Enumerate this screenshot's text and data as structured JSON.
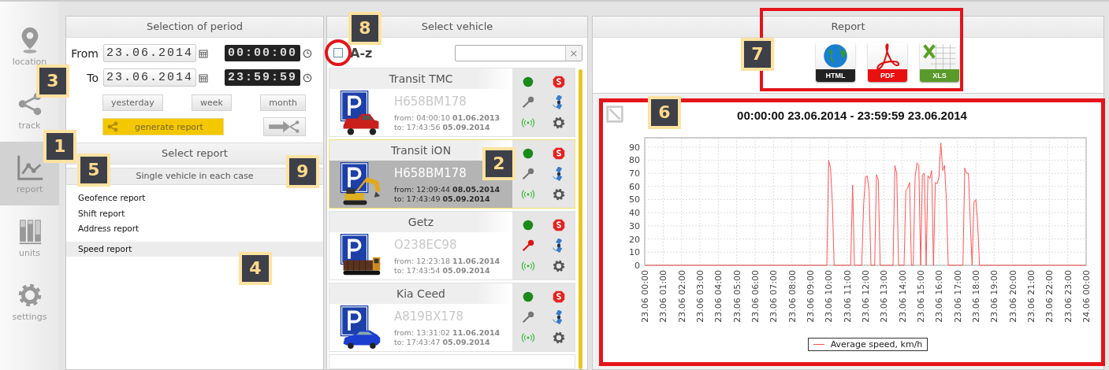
{
  "sidebar": {
    "items": [
      {
        "label": "location",
        "selected": false
      },
      {
        "label": "track",
        "selected": false
      },
      {
        "label": "report",
        "selected": true
      },
      {
        "label": "units",
        "selected": false
      },
      {
        "label": "settings",
        "selected": false
      }
    ]
  },
  "period": {
    "title": "Selection of period",
    "rows": [
      {
        "label": "From",
        "date": "23.06.2014",
        "time": "00:00:00"
      },
      {
        "label": "To",
        "date": "23.06.2014",
        "time": "23:59:59"
      }
    ],
    "presets": [
      "yesterday",
      "week",
      "month"
    ],
    "generate": "generate report"
  },
  "reports": {
    "title": "Select report",
    "group": "Single vehicle in each case",
    "items": [
      {
        "label": "Geofence report",
        "selected": false
      },
      {
        "label": "Shift report",
        "selected": false
      },
      {
        "label": "Address report",
        "selected": false
      },
      {
        "label": "Speed report",
        "selected": true
      }
    ]
  },
  "vehicles": {
    "title": "Select vehicle",
    "sort_label": "A-z",
    "sort_checked": false,
    "sort_highlighted": true,
    "search_clear": "×",
    "items": [
      {
        "name": "Transit TMC",
        "plate": "H658BM178",
        "from": "from: 04:00:10 **01.06.2013**",
        "to": "to: 17:43:56 **05.09.2014**",
        "kind": "pickup",
        "selected": false,
        "key_on": false
      },
      {
        "name": "Transit iON",
        "plate": "H658BM178",
        "from": "from: 12:09:44 **08.05.2014**",
        "to": "to: 17:43:49 **05.09.2014**",
        "kind": "excavator",
        "selected": true,
        "key_on": false
      },
      {
        "name": "Getz",
        "plate": "O238EC98",
        "from": "from: 12:23:18 **11.06.2014**",
        "to": "to: 17:43:54 **05.09.2014**",
        "kind": "truck",
        "selected": false,
        "key_on": true
      },
      {
        "name": "Kia Ceed",
        "plate": "A819BX178",
        "from": "from: 13:31:02 **11.06.2014**",
        "to": "to: 17:43:47 **05.09.2014**",
        "kind": "car",
        "selected": false,
        "key_on": false
      }
    ]
  },
  "report": {
    "title": "Report",
    "export_highlighted": true,
    "exports": [
      {
        "label": "HTML",
        "kind": "html"
      },
      {
        "label": "PDF",
        "kind": "pdf"
      },
      {
        "label": "XLS",
        "kind": "xls"
      }
    ],
    "chart_highlighted": true,
    "chart_title": "00:00:00 23.06.2014 - 23:59:59 23.06.2014",
    "chart_data": {
      "type": "line",
      "grid": true,
      "ylim": [
        0,
        97
      ],
      "yticks": [
        0,
        10,
        20,
        30,
        40,
        50,
        60,
        70,
        80,
        90
      ],
      "categories": [
        "23.06 00:00",
        null,
        null,
        null,
        null,
        null,
        null,
        null,
        null,
        null,
        "23.06 01:00",
        null,
        null,
        null,
        null,
        null,
        null,
        null,
        null,
        null,
        "23.06 02:00",
        null,
        null,
        null,
        null,
        null,
        null,
        null,
        null,
        null,
        "23.06 03:00",
        null,
        null,
        null,
        null,
        null,
        null,
        null,
        null,
        null,
        "23.06 04:00",
        null,
        null,
        null,
        null,
        null,
        null,
        null,
        null,
        null,
        "23.06 05:00",
        null,
        null,
        null,
        null,
        null,
        null,
        null,
        null,
        null,
        "23.06 06:00",
        null,
        null,
        null,
        null,
        null,
        null,
        null,
        null,
        null,
        "23.06 07:00",
        null,
        null,
        null,
        null,
        null,
        null,
        null,
        null,
        null,
        "23.06 08:00",
        null,
        null,
        null,
        null,
        null,
        null,
        null,
        null,
        null,
        "23.06 09:00",
        null,
        null,
        null,
        null,
        null,
        null,
        null,
        null,
        null,
        "23.06 10:00",
        null,
        null,
        null,
        null,
        null,
        null,
        null,
        null,
        null,
        "23.06 11:00",
        null,
        null,
        null,
        null,
        null,
        null,
        null,
        null,
        null,
        "23.06 12:00",
        null,
        null,
        null,
        null,
        null,
        null,
        null,
        null,
        null,
        "23.06 13:00",
        null,
        null,
        null,
        null,
        null,
        null,
        null,
        null,
        null,
        "23.06 14:00",
        null,
        null,
        null,
        null,
        null,
        null,
        null,
        null,
        null,
        "23.06 15:00",
        null,
        null,
        null,
        null,
        null,
        null,
        null,
        null,
        null,
        "23.06 16:00",
        null,
        null,
        null,
        null,
        null,
        null,
        null,
        null,
        null,
        "23.06 17:00",
        null,
        null,
        null,
        null,
        null,
        null,
        null,
        null,
        null,
        "23.06 18:00",
        null,
        null,
        null,
        null,
        null,
        null,
        null,
        null,
        null,
        "23.06 19:00",
        null,
        null,
        null,
        null,
        null,
        null,
        null,
        null,
        null,
        "23.06 20:00",
        null,
        null,
        null,
        null,
        null,
        null,
        null,
        null,
        null,
        "23.06 21:00",
        null,
        null,
        null,
        null,
        null,
        null,
        null,
        null,
        null,
        "23.06 22:00",
        null,
        null,
        null,
        null,
        null,
        null,
        null,
        null,
        null,
        "23.06 23:00",
        null,
        null,
        null,
        null,
        null,
        null,
        null,
        null,
        null,
        "24.06 00:00"
      ],
      "series": [
        {
          "name": "Average speed, km/h",
          "color": "#ff5555",
          "values": [
            0,
            0,
            0,
            0,
            0,
            0,
            0,
            0,
            0,
            0,
            0,
            0,
            0,
            0,
            0,
            0,
            0,
            0,
            0,
            0,
            0,
            0,
            0,
            0,
            0,
            0,
            0,
            0,
            0,
            0,
            0,
            0,
            0,
            0,
            0,
            0,
            0,
            0,
            0,
            0,
            0,
            0,
            0,
            0,
            0,
            0,
            0,
            0,
            0,
            0,
            0,
            0,
            0,
            0,
            0,
            0,
            0,
            0,
            0,
            0,
            0,
            0,
            0,
            0,
            0,
            0,
            0,
            0,
            0,
            0,
            0,
            0,
            0,
            0,
            0,
            0,
            0,
            0,
            0,
            0,
            0,
            0,
            0,
            0,
            0,
            0,
            0,
            0,
            0,
            0,
            0,
            0,
            0,
            0,
            0,
            0,
            0,
            0,
            0,
            0,
            80,
            74,
            48,
            0,
            0,
            0,
            0,
            0,
            0,
            0,
            0,
            0,
            0,
            61,
            0,
            0,
            0,
            0,
            0,
            46,
            67,
            68,
            56,
            0,
            0,
            0,
            69,
            65,
            0,
            0,
            0,
            0,
            0,
            0,
            0,
            0,
            76,
            70,
            0,
            0,
            0,
            0,
            57,
            59,
            63,
            0,
            0,
            67,
            78,
            76,
            0,
            69,
            70,
            0,
            68,
            66,
            72,
            0,
            63,
            62,
            67,
            93,
            72,
            76,
            50,
            0,
            0,
            0,
            0,
            0,
            0,
            0,
            0,
            0,
            74,
            70,
            70,
            33,
            0,
            48,
            50,
            33,
            0,
            0,
            0,
            0,
            0,
            0,
            0,
            0,
            0,
            0,
            0,
            0,
            0,
            0,
            0,
            0,
            0,
            0,
            0,
            0,
            0,
            0,
            0,
            0,
            0,
            0,
            0,
            0,
            0,
            0,
            0,
            0,
            0,
            0,
            0,
            0,
            0,
            0,
            0,
            0,
            0,
            0,
            0,
            0,
            0,
            0,
            0,
            0,
            0,
            0,
            0,
            0,
            0,
            0,
            0,
            0,
            0,
            0,
            0
          ]
        }
      ]
    }
  },
  "callouts": [
    "1",
    "2",
    "3",
    "4",
    "5",
    "6",
    "7",
    "8",
    "9"
  ]
}
